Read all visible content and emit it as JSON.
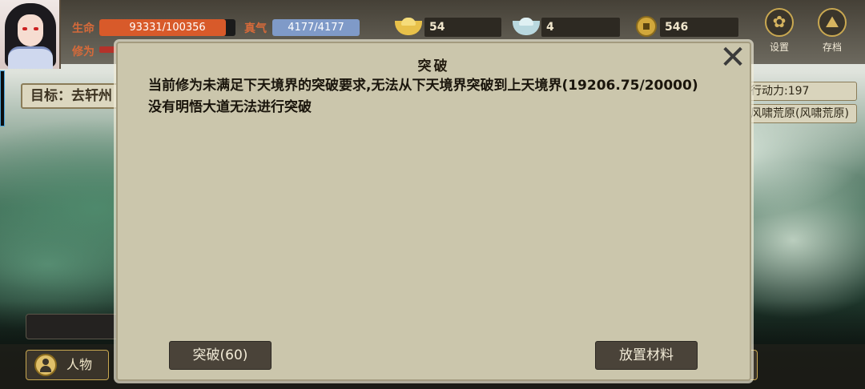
{
  "hud": {
    "hp_label": "生命",
    "hp_value": "93331/100356",
    "hp_fraction": 0.93,
    "qi_label": "真气",
    "qi_value": "4177/4177",
    "cultivation_label": "修为",
    "gold": "54",
    "silver": "4",
    "coins": "546",
    "settings_label": "设置",
    "save_label": "存档"
  },
  "side": {
    "goal_text": "目标：去轩州",
    "action_points": "行动力:197",
    "location": "风啸荒原(风啸荒原)"
  },
  "bottom": {
    "character_label": "人物"
  },
  "modal": {
    "title": "突破",
    "close_symbol": "✕",
    "line1": "当前修为未满足下天境界的突破要求,无法从下天境界突破到上天境界(19206.75/20000)",
    "line2": "没有明悟大道无法进行突破",
    "breakthrough_button": "突破(60)",
    "place_materials_button": "放置材料"
  },
  "colors": {
    "hp_fill": "#d85a2a",
    "qi_bar": "#7f9ac8",
    "modal_bg": "#cbc6ac",
    "button_bg": "#4a4339"
  }
}
